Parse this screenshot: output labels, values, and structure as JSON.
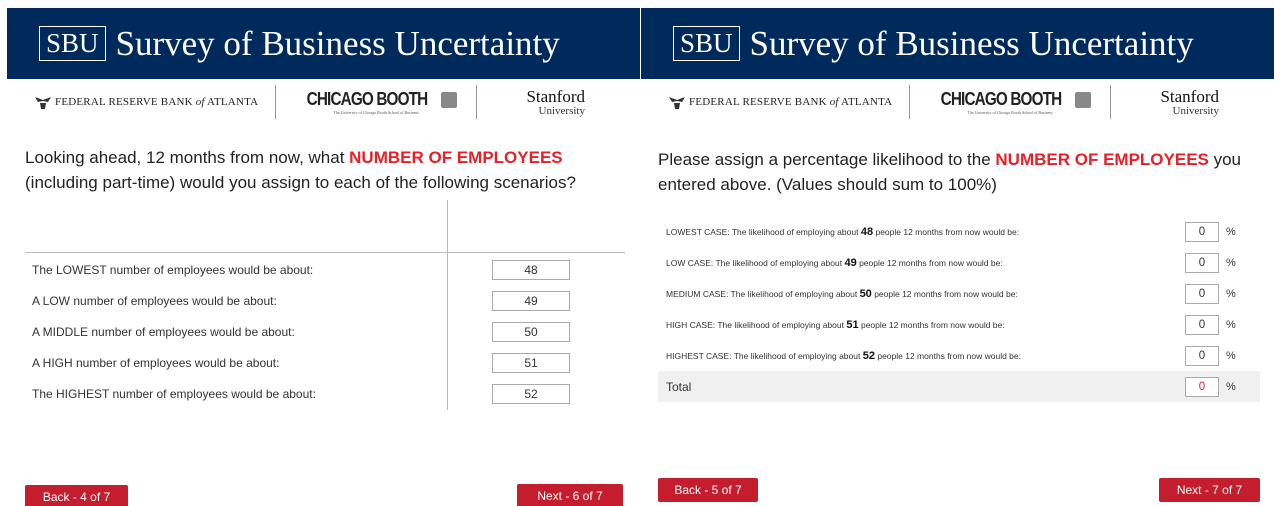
{
  "banner": {
    "sbu": "SBU",
    "title": "Survey of Business Uncertainty"
  },
  "logos": {
    "frb_prefix": "FEDERAL RESERVE BANK ",
    "frb_of": "of",
    "frb_suffix": " ATLANTA",
    "booth": "CHICAGO BOOTH",
    "booth_sub": "The University of Chicago Booth School of Business",
    "stanford_1": "Stanford",
    "stanford_2": "University"
  },
  "left": {
    "question_pre": "Looking ahead, 12 months from now, what ",
    "question_emph": "NUMBER OF EMPLOYEES",
    "question_post": " (including part-time) would you assign to each of the following scenarios?",
    "rows": [
      {
        "label": "The LOWEST number of employees would be about:",
        "value": "48"
      },
      {
        "label": "A LOW number of employees would be about:",
        "value": "49"
      },
      {
        "label": "A MIDDLE number of employees would be about:",
        "value": "50"
      },
      {
        "label": "A HIGH number of employees would be about:",
        "value": "51"
      },
      {
        "label": "The HIGHEST number of employees would be about:",
        "value": "52"
      }
    ],
    "back_label": "Back - 4 of 7",
    "next_label": "Next - 6 of 7"
  },
  "right": {
    "question_pre": "Please assign a percentage likelihood to the ",
    "question_emph": "NUMBER OF EMPLOYEES",
    "question_post": " you entered above.  (Values should sum to 100%)",
    "row_mid": "people 12 months from now would be:",
    "rows": [
      {
        "case": "LOWEST CASE: The likelihood of employing about",
        "num": "48",
        "value": "0"
      },
      {
        "case": "LOW CASE: The likelihood of employing about",
        "num": "49",
        "value": "0"
      },
      {
        "case": "MEDIUM CASE: The likelihood of employing about",
        "num": "50",
        "value": "0"
      },
      {
        "case": "HIGH CASE: The likelihood of employing about",
        "num": "51",
        "value": "0"
      },
      {
        "case": "HIGHEST CASE: The likelihood of employing about",
        "num": "52",
        "value": "0"
      }
    ],
    "pct_sign": "%",
    "total_label": "Total",
    "total_value": "0",
    "back_label": "Back - 5 of 7",
    "next_label": "Next - 7 of 7"
  },
  "colors": {
    "banner": "#002a5c",
    "accent": "#e81f26",
    "button": "#c41e2e"
  }
}
